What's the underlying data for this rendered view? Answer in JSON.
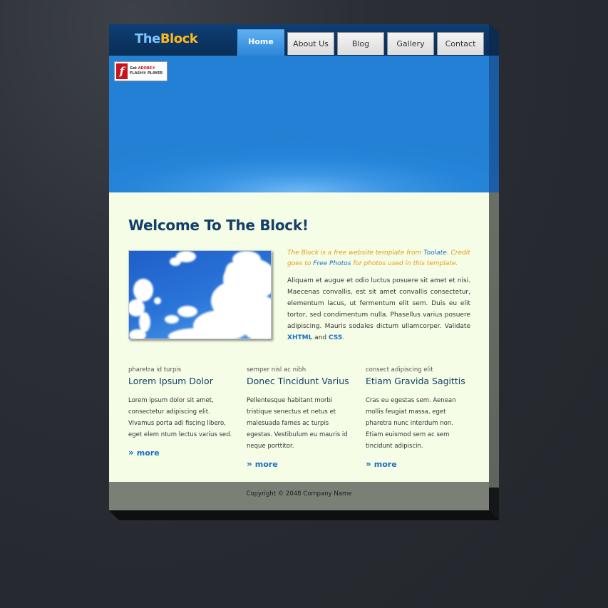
{
  "logo": {
    "part1": "The",
    "part2": "Block"
  },
  "nav": {
    "tabs": [
      {
        "label": "Home",
        "active": true
      },
      {
        "label": "About Us",
        "active": false
      },
      {
        "label": "Blog",
        "active": false
      },
      {
        "label": "Gallery",
        "active": false
      },
      {
        "label": "Contact",
        "active": false
      }
    ]
  },
  "flash_badge": {
    "line1_prefix": "Get ",
    "line1_brand": "ADOBE®",
    "line2": "FLASH® PLAYER",
    "icon": "flash-player-icon"
  },
  "main": {
    "welcome_title": "Welcome To The Block!",
    "intro_lead_1": "The Block is a free website template from ",
    "intro_lead_link1": "Toolate",
    "intro_lead_2": ". Credit goes to ",
    "intro_lead_link2": "Free Photos",
    "intro_lead_3": " for photos used in this template.",
    "intro_body": "Aliquam et augue et odio luctus posuere sit amet et nisi. Maecenas convallis, est sit amet convallis consectetur, elementum lacus, ut fermentum elit sem. Duis eu elit tortor, sed condimentum nulla. Phasellus varius posuere adipiscing. Mauris sodales dictum ullamcorper. Validate ",
    "xhtml_link": "XHTML",
    "and_text": " and ",
    "css_link": "CSS",
    "period": "."
  },
  "columns": [
    {
      "kicker": "pharetra id turpis",
      "title": "Lorem Ipsum Dolor",
      "text": "Lorem ipsum dolor sit amet, consectetur adipiscing elit. Vivamus porta adi fiscing libero, eget elem ntum lectus varius sed.",
      "more": "more"
    },
    {
      "kicker": "semper nisl ac nibh",
      "title": "Donec Tincidunt Varius",
      "text": "Pellentesque habitant morbi tristique senectus et netus et malesuada fames ac turpis egestas. Vestibulum eu mauris id neque porttitor.",
      "more": "more"
    },
    {
      "kicker": "consect adipiscing elit",
      "title": "Etiam Gravida Sagittis",
      "text": "Cras eu egestas sem. Aenean mollis feugiat massa, eget pharetra nunc interdum non. Etiam euismod sem ac sem tincidunt adipiscin.",
      "more": "more"
    }
  ],
  "footer": {
    "copyright": "Copyright © 2048 Company Name"
  },
  "colors": {
    "header": "#0b3462",
    "banner": "#2585d8",
    "content_bg": "#f5fde6",
    "footer_bg": "#7b8077",
    "title": "#133f68",
    "accent_orange": "#e89a10",
    "link_blue": "#1a6fc4",
    "logo_the": "#7cc4ff",
    "logo_block": "#ffb81c"
  }
}
